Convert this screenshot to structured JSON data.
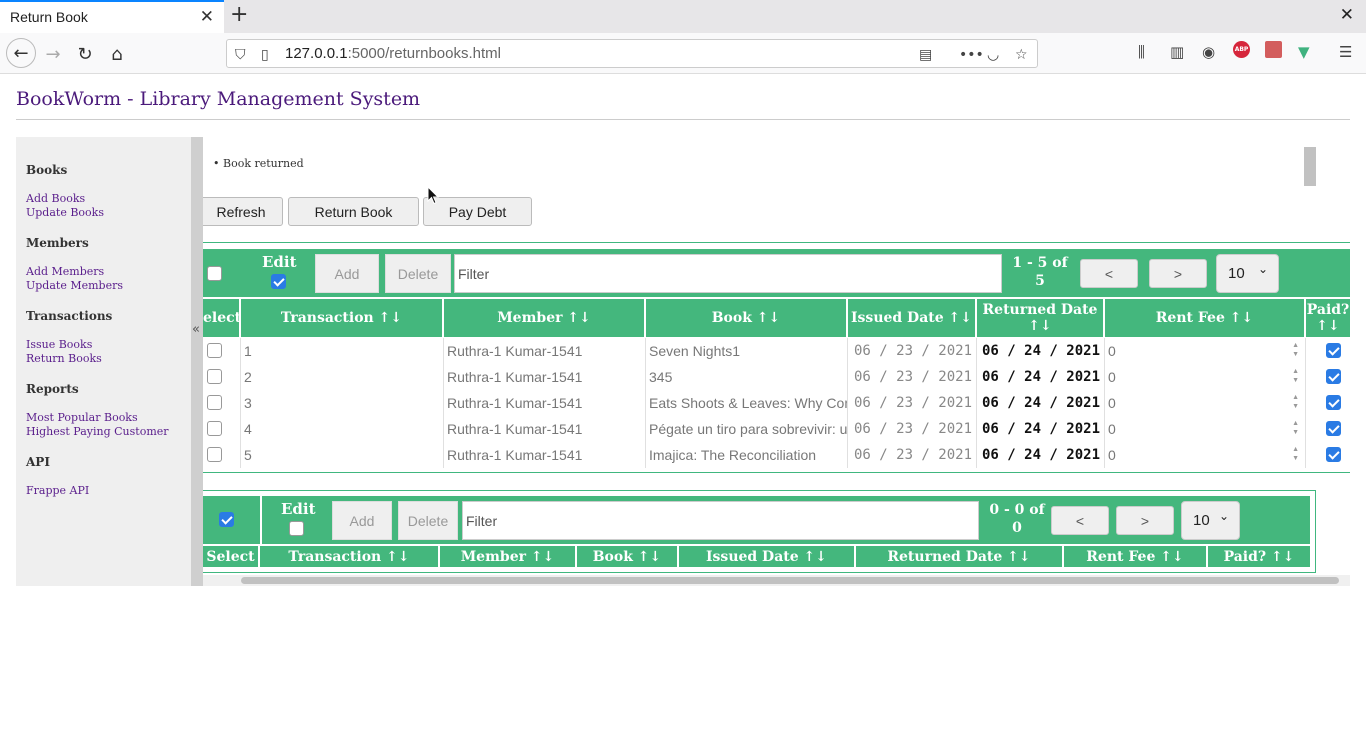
{
  "browser": {
    "tab_title": "Return Book",
    "url_host": "127.0.0.1",
    "url_rest": ":5000/returnbooks.html"
  },
  "page": {
    "title": "BookWorm - Library Management System"
  },
  "sidebar": {
    "sections": [
      {
        "heading": "Books",
        "links": [
          "Add Books",
          "Update Books"
        ]
      },
      {
        "heading": "Members",
        "links": [
          "Add Members",
          "Update Members"
        ]
      },
      {
        "heading": "Transactions",
        "links": [
          "Issue Books",
          "Return Books"
        ]
      },
      {
        "heading": "Reports",
        "links": [
          "Most Popular Books",
          "Highest Paying Customer"
        ]
      },
      {
        "heading": "API",
        "links": [
          "Frappe API"
        ]
      }
    ],
    "collapse_glyph": "«"
  },
  "message": "Book returned",
  "actions": {
    "refresh": "Refresh",
    "return_book": "Return Book",
    "pay_debt": "Pay Debt"
  },
  "table1": {
    "edit_label": "Edit",
    "edit_checked": true,
    "add_label": "Add",
    "delete_label": "Delete",
    "filter_placeholder": "Filter",
    "pager_line1": "1 - 5 of",
    "pager_line2": "5",
    "prev": "<",
    "next": ">",
    "page_size": "10",
    "headers": {
      "select": "elect",
      "transaction": "Transaction ↑↓",
      "member": "Member ↑↓",
      "book": "Book ↑↓",
      "issued": "Issued Date ↑↓",
      "returned_l1": "Returned Date",
      "returned_l2": "↑↓",
      "rent": "Rent Fee ↑↓",
      "paid_l1": "Paid?",
      "paid_l2": "↑↓"
    },
    "rows": [
      {
        "transaction": "1",
        "member": "Ruthra-1 Kumar-1541",
        "book": "Seven Nights1",
        "issued": "06 / 23 / 2021",
        "returned": "06 / 24 / 2021",
        "rent": "0",
        "paid": true
      },
      {
        "transaction": "2",
        "member": "Ruthra-1 Kumar-1541",
        "book": "345",
        "issued": "06 / 23 / 2021",
        "returned": "06 / 24 / 2021",
        "rent": "0",
        "paid": true
      },
      {
        "transaction": "3",
        "member": "Ruthra-1 Kumar-1541",
        "book": "Eats  Shoots & Leaves: Why  Commas Really Do Make a Difference!",
        "issued": "06 / 23 / 2021",
        "returned": "06 / 24 / 2021",
        "rent": "0",
        "paid": true
      },
      {
        "transaction": "4",
        "member": "Ruthra-1 Kumar-1541",
        "book": "Pégate un tiro para sobrevivir: un viaje personal por la América de los mitos",
        "issued": "06 / 23 / 2021",
        "returned": "06 / 24 / 2021",
        "rent": "0",
        "paid": true
      },
      {
        "transaction": "5",
        "member": "Ruthra-1 Kumar-1541",
        "book": "Imajica: The Reconciliation",
        "issued": "06 / 23 / 2021",
        "returned": "06 / 24 / 2021",
        "rent": "0",
        "paid": true
      }
    ]
  },
  "table2": {
    "select_all_checked": true,
    "edit_label": "Edit",
    "edit_checked": false,
    "add_label": "Add",
    "delete_label": "Delete",
    "filter_placeholder": "Filter",
    "pager_line1": "0 - 0 of",
    "pager_line2": "0",
    "prev": "<",
    "next": ">",
    "page_size": "10",
    "headers": {
      "select": "Select",
      "transaction": "Transaction ↑↓",
      "member": "Member ↑↓",
      "book": "Book ↑↓",
      "issued": "Issued Date ↑↓",
      "returned": "Returned Date ↑↓",
      "rent": "Rent Fee ↑↓",
      "paid": "Paid? ↑↓"
    }
  },
  "colors": {
    "accent_green": "#44b77d",
    "link_purple": "#5a1e8c",
    "title_purple": "#4b1a7b",
    "checkbox_blue": "#2a7be4"
  }
}
